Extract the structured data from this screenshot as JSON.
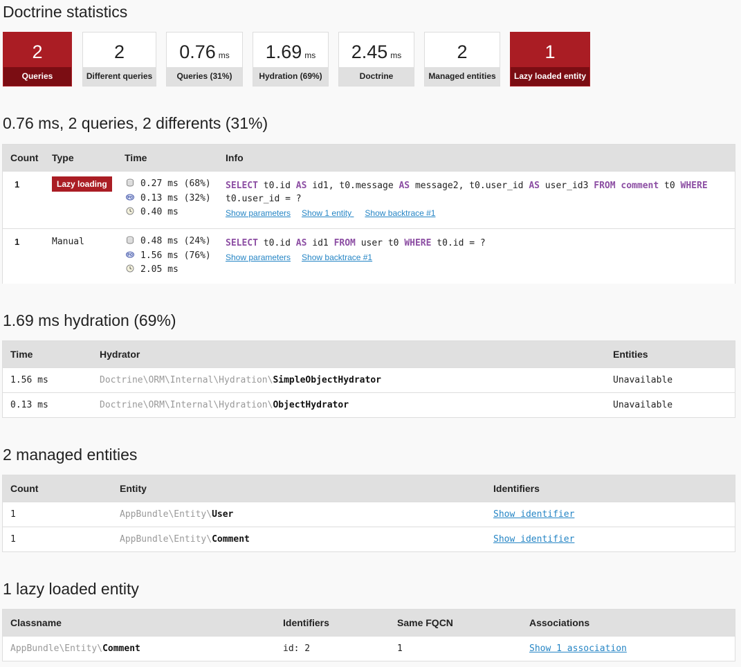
{
  "page_title": "Doctrine statistics",
  "metrics": [
    {
      "value": "2",
      "unit": "",
      "label": "Queries",
      "highlight": true
    },
    {
      "value": "2",
      "unit": "",
      "label": "Different queries",
      "highlight": false
    },
    {
      "value": "0.76",
      "unit": "ms",
      "label": "Queries (31%)",
      "highlight": false
    },
    {
      "value": "1.69",
      "unit": "ms",
      "label": "Hydration (69%)",
      "highlight": false
    },
    {
      "value": "2.45",
      "unit": "ms",
      "label": "Doctrine",
      "highlight": false
    },
    {
      "value": "2",
      "unit": "",
      "label": "Managed entities",
      "highlight": false
    },
    {
      "value": "1",
      "unit": "",
      "label": "Lazy loaded entity",
      "highlight": true
    }
  ],
  "queries": {
    "title": "0.76 ms, 2 queries, 2 differents (31%)",
    "headers": {
      "count": "Count",
      "type": "Type",
      "time": "Time",
      "info": "Info"
    },
    "rows": [
      {
        "count": "1",
        "type": "Lazy loading",
        "times": [
          "0.27 ms (68%)",
          "0.13 ms (32%)",
          "0.40 ms"
        ],
        "sql_line1": [
          {
            "t": "SELECT",
            "kw": true
          },
          {
            "t": " t0.id ",
            "kw": false
          },
          {
            "t": "AS",
            "kw": true
          },
          {
            "t": " id1, t0.message ",
            "kw": false
          },
          {
            "t": "AS",
            "kw": true
          },
          {
            "t": " message2, t0.user_id ",
            "kw": false
          },
          {
            "t": "AS",
            "kw": true
          },
          {
            "t": " user_id3 ",
            "kw": false
          },
          {
            "t": "FROM",
            "kw": true
          },
          {
            "t": " ",
            "kw": false
          },
          {
            "t": "comment",
            "kw": true
          },
          {
            "t": " t0 ",
            "kw": false
          },
          {
            "t": "WHERE",
            "kw": true
          }
        ],
        "sql_line2": "t0.user_id = ?",
        "links": [
          "Show parameters",
          "Show 1 entity ",
          "Show backtrace #1"
        ]
      },
      {
        "count": "1",
        "type": "Manual",
        "times": [
          "0.48 ms (24%)",
          "1.56 ms (76%)",
          "2.05 ms"
        ],
        "sql_line1": [
          {
            "t": "SELECT",
            "kw": true
          },
          {
            "t": " t0.id ",
            "kw": false
          },
          {
            "t": "AS",
            "kw": true
          },
          {
            "t": " id1 ",
            "kw": false
          },
          {
            "t": "FROM",
            "kw": true
          },
          {
            "t": " user t0 ",
            "kw": false
          },
          {
            "t": "WHERE",
            "kw": true
          },
          {
            "t": " t0.id = ?",
            "kw": false
          }
        ],
        "sql_line2": "",
        "links": [
          "Show parameters",
          "Show backtrace #1"
        ]
      }
    ]
  },
  "hydration": {
    "title": "1.69 ms hydration (69%)",
    "headers": {
      "time": "Time",
      "hydrator": "Hydrator",
      "entities": "Entities"
    },
    "rows": [
      {
        "time": "1.56 ms",
        "namespace": "Doctrine\\ORM\\Internal\\Hydration\\",
        "class": "SimpleObjectHydrator",
        "entities": "Unavailable"
      },
      {
        "time": "0.13 ms",
        "namespace": "Doctrine\\ORM\\Internal\\Hydration\\",
        "class": "ObjectHydrator",
        "entities": "Unavailable"
      }
    ]
  },
  "managed": {
    "title": "2 managed entities",
    "headers": {
      "count": "Count",
      "entity": "Entity",
      "identifiers": "Identifiers"
    },
    "rows": [
      {
        "count": "1",
        "namespace": "AppBundle\\Entity\\",
        "class": "User",
        "link": "Show identifier"
      },
      {
        "count": "1",
        "namespace": "AppBundle\\Entity\\",
        "class": "Comment",
        "link": "Show identifier"
      }
    ]
  },
  "lazy": {
    "title": "1 lazy loaded entity",
    "headers": {
      "classname": "Classname",
      "identifiers": "Identifiers",
      "same_fqcn": "Same FQCN",
      "associations": "Associations"
    },
    "rows": [
      {
        "namespace": "AppBundle\\Entity\\",
        "class": "Comment",
        "identifiers": "id: 2",
        "same_fqcn": "1",
        "link": "Show 1 association"
      }
    ]
  },
  "colors": {
    "accent_red": "#aa1d24",
    "dark_red": "#7b0d13",
    "link": "#2585c5",
    "sql_keyword": "#8c4ea3"
  }
}
